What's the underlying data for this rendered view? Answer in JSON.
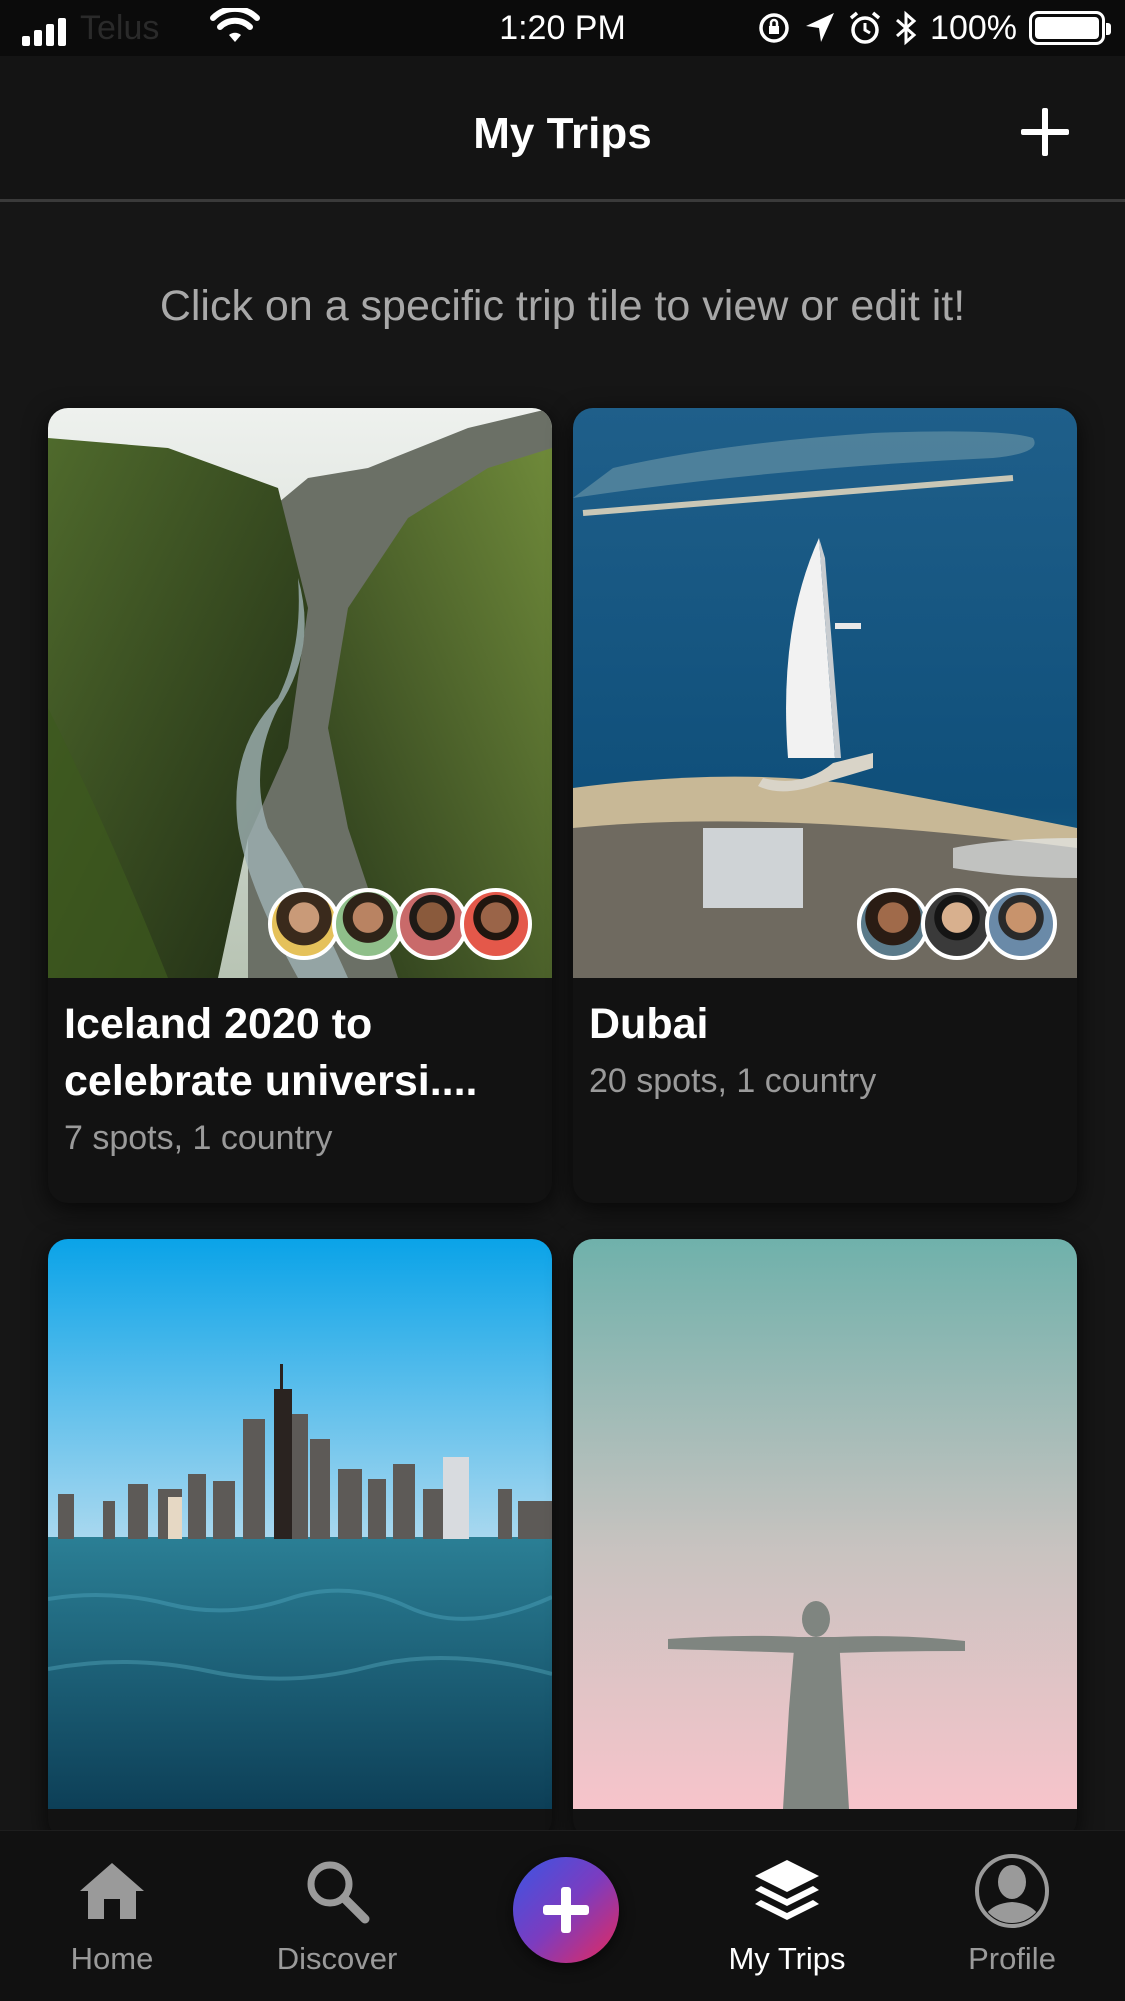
{
  "status_bar": {
    "carrier": "Telus",
    "time": "1:20 PM",
    "battery": "100%"
  },
  "nav": {
    "title": "My Trips"
  },
  "hint": "Click on a specific trip tile to view or edit it!",
  "trips": [
    {
      "title_line1": "Iceland 2020 to",
      "title_line2": "celebrate universi....",
      "meta": "7 spots, 1 country"
    },
    {
      "title_line1": "Dubai",
      "meta": "20 spots, 1 country"
    }
  ],
  "tabs": [
    {
      "label": "Home",
      "icon": "home-icon"
    },
    {
      "label": "Discover",
      "icon": "search-icon"
    },
    {
      "label": "",
      "icon": "plus-icon"
    },
    {
      "label": "My Trips",
      "icon": "layers-icon"
    },
    {
      "label": "Profile",
      "icon": "profile-icon"
    }
  ],
  "colors": {
    "background": "#161616",
    "fab_gradient_start": "#3a56e4",
    "fab_gradient_end": "#e8295a",
    "tab_active": "#ffffff",
    "tab_inactive": "#9a9a9a"
  }
}
